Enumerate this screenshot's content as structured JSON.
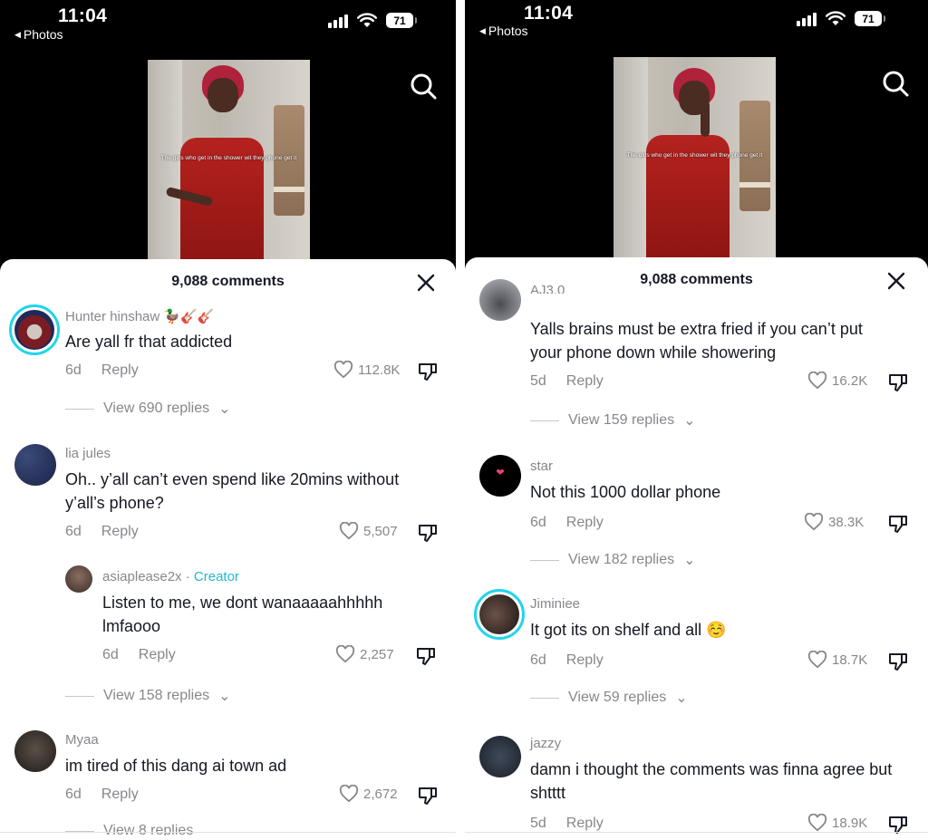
{
  "left": {
    "status": {
      "time": "11:04",
      "back_label": "Photos",
      "battery": "71"
    },
    "video": {
      "caption": "The girls who get in the shower wit they phone get it"
    },
    "sheet": {
      "title": "9,088 comments",
      "comments": [
        {
          "user": "Hunter hinshaw 🦆🎸🎸",
          "text": "Are yall fr that addicted",
          "age": "6d",
          "reply": "Reply",
          "likes": "112.8K",
          "view_replies": "View 690 replies"
        },
        {
          "user": "lia jules",
          "text": "Oh.. y’all can’t even spend like 20mins without y’all’s phone?",
          "age": "6d",
          "reply": "Reply",
          "likes": "5,507"
        },
        {
          "user": "asiaplease2x",
          "creator_sep": " · ",
          "creator_label": "Creator",
          "text": "Listen to me, we dont wanaaaaahhhhh lmfaooo",
          "age": "6d",
          "reply": "Reply",
          "likes": "2,257",
          "view_replies": "View 158 replies"
        },
        {
          "user": "Myaa",
          "text": "im tired of this dang ai town ad",
          "age": "6d",
          "reply": "Reply",
          "likes": "2,672",
          "view_replies": "View 8 replies"
        }
      ]
    }
  },
  "right": {
    "status": {
      "time": "11:04",
      "back_label": "Photos",
      "battery": "71"
    },
    "video": {
      "caption": "The girls who get in the shower wit they phone get it"
    },
    "sheet": {
      "title": "9,088 comments",
      "comments": [
        {
          "user": "AJ3.0",
          "text": "Yalls brains must be extra fried if you can’t put your phone down while showering",
          "age": "5d",
          "reply": "Reply",
          "likes": "16.2K",
          "view_replies": "View 159 replies"
        },
        {
          "user": "star",
          "text": "Not this 1000 dollar phone",
          "age": "6d",
          "reply": "Reply",
          "likes": "38.3K",
          "view_replies": "View 182 replies"
        },
        {
          "user": "Jiminiee",
          "text": "It got its on shelf and all ☺️",
          "age": "6d",
          "reply": "Reply",
          "likes": "18.7K",
          "view_replies": "View 59 replies"
        },
        {
          "user": "jazzy",
          "text": "damn i thought the comments was finna agree but shtttt",
          "age": "5d",
          "reply": "Reply",
          "likes": "18.9K"
        }
      ]
    }
  }
}
